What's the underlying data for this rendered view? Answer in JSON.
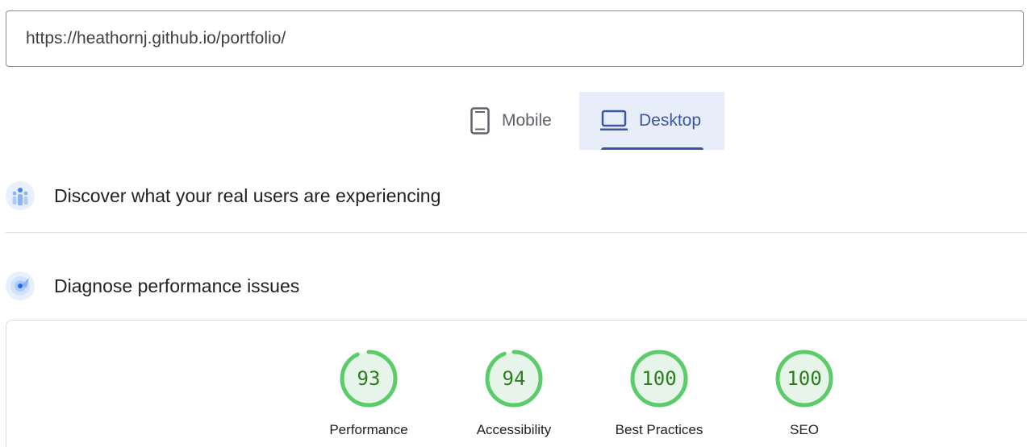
{
  "url_input": {
    "value": "https://heathornj.github.io/portfolio/"
  },
  "device_tabs": [
    {
      "label": "Mobile",
      "icon": "smartphone-icon",
      "selected": false
    },
    {
      "label": "Desktop",
      "icon": "laptop-icon",
      "selected": true
    }
  ],
  "sections": {
    "crux": {
      "title": "Discover what your real users are experiencing",
      "icon": "real-users-icon"
    },
    "diagnose": {
      "title": "Diagnose performance issues",
      "icon": "lighthouse-icon"
    }
  },
  "scores": [
    {
      "value": 93,
      "label": "Performance"
    },
    {
      "value": 94,
      "label": "Accessibility"
    },
    {
      "value": 100,
      "label": "Best Practices"
    },
    {
      "value": 100,
      "label": "SEO"
    }
  ],
  "colors": {
    "accent": "#3c55a5",
    "tab_active_bg": "#e8eef9",
    "score_pass_ring": "#5ccc6a",
    "score_pass_text": "#2d7d1f",
    "score_track": "#e6f4ea"
  }
}
